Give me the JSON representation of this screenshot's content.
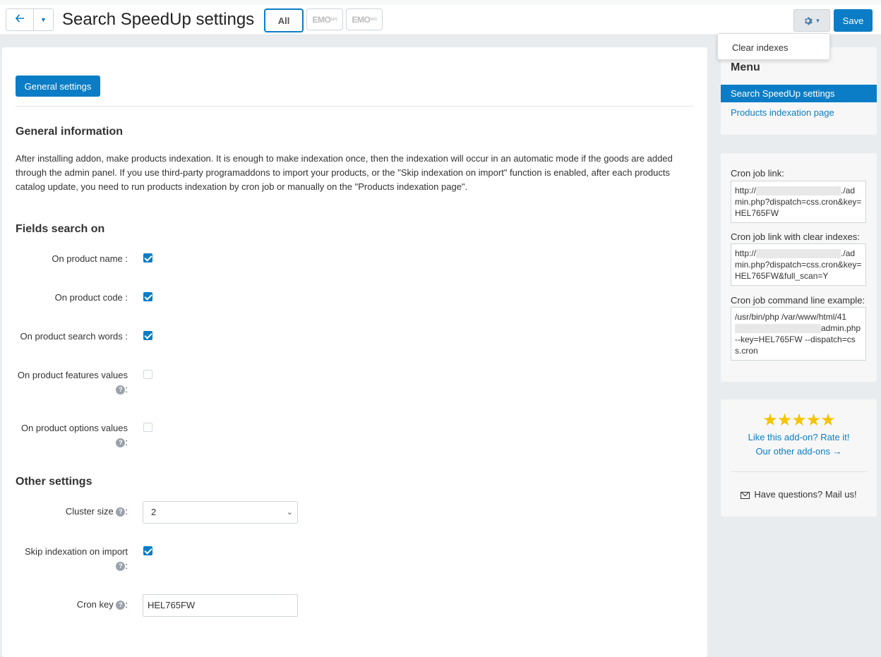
{
  "header": {
    "back_icon": "arrow-left-icon",
    "title": "Search SpeedUp settings",
    "store_tabs": [
      "All",
      "EMO",
      "EMO"
    ],
    "store_tab_suffix": "MAI",
    "save_label": "Save",
    "dropdown_item": "Clear indexes"
  },
  "main": {
    "tab_label": "General settings",
    "general_info_title": "General information",
    "general_info_text": "After installing addon, make products indexation. It is enough to make indexation once, then the indexation will occur in an automatic mode if the goods are added through the admin panel. If you use third-party programaddons to import your products, or the \"Skip indexation on import\" function is enabled, after each products catalog update, you need to run products indexation by cron job or manually on the \"Products indexation page\".",
    "fields_title": "Fields search on",
    "fields": [
      {
        "label": "On product name :",
        "checked": true
      },
      {
        "label": "On product code :",
        "checked": true
      },
      {
        "label": "On product search words :",
        "checked": true
      },
      {
        "label": "On product features values",
        "checked": false
      },
      {
        "label": "On product options values",
        "checked": false
      }
    ],
    "other_title": "Other settings",
    "cluster_label": "Cluster size",
    "cluster_value": "2",
    "skip_label": "Skip indexation on import",
    "skip_checked": true,
    "cron_key_label": "Cron key",
    "cron_key_value": "HEL765FW",
    "colon": ":"
  },
  "sidebar": {
    "menu_title": "Menu",
    "menu_active": "Search SpeedUp settings",
    "menu_link": "Products indexation page",
    "cron_link_label": "Cron job link:",
    "cron_link_prefix": "http://",
    "cron_link_suffix": "./admin.php?dispatch=css.cron&key=HEL765FW",
    "cron_clear_label": "Cron job link with clear indexes:",
    "cron_clear_suffix": "./admin.php?dispatch=css.cron&key=HEL765FW&full_scan=Y",
    "cron_cmd_label": "Cron job command line example:",
    "cron_cmd_line1": "/usr/bin/php /var/www/html/41",
    "cron_cmd_line2": "admin.php",
    "cron_cmd_line3": "--key=HEL765FW --dispatch=css.cron",
    "stars": "★★★★★",
    "rate_link": "Like this add-on? Rate it!",
    "other_addons": "Our other add-ons →",
    "mail_text": "Have questions? Mail us!"
  },
  "colors": {
    "accent": "#0b7dc6",
    "star": "#f5c300"
  }
}
